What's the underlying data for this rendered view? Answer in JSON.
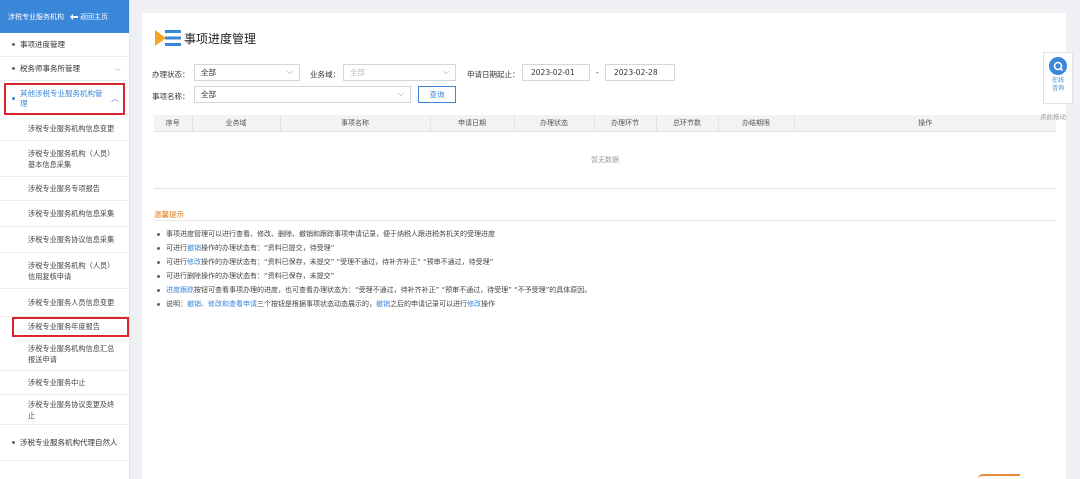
{
  "sidebar": {
    "top_title": "涉税专业服务机构",
    "back_label": "返回主页",
    "items": [
      {
        "label": "事项进度管理"
      },
      {
        "label": "税务师事务所管理"
      },
      {
        "label": "其他涉税专业服务机构管理"
      }
    ],
    "subitems": [
      {
        "label": "涉税专业服务机构信息变更"
      },
      {
        "label": "涉税专业服务机构（人员）基本信息采集"
      },
      {
        "label": "涉税专业服务专项报告"
      },
      {
        "label": "涉税专业服务机构信息采集"
      },
      {
        "label": "涉税专业服务协议信息采集"
      },
      {
        "label": "涉税专业服务机构（人员）信用复核申请"
      },
      {
        "label": "涉税专业服务人员信息变更"
      },
      {
        "label": "涉税专业服务年度报告"
      },
      {
        "label": "涉税专业服务机构信息汇总报送申请"
      },
      {
        "label": "涉税专业服务中止"
      },
      {
        "label": "涉税专业服务协议变更及终止"
      }
    ],
    "bottom_item": {
      "label": "涉税专业服务机构代理自然人"
    }
  },
  "page": {
    "title": "事项进度管理"
  },
  "filters": {
    "status_label": "办理状态：",
    "status_value": "全部",
    "business_label": "业务域：",
    "business_value": "全部",
    "date_label": "申请日期起止：",
    "date_from": "2023-02-01",
    "date_sep": "-",
    "date_to": "2023-02-28",
    "item_label": "事项名称：",
    "item_value": "全部",
    "query_button": "查询"
  },
  "table": {
    "columns": [
      "序号",
      "业务域",
      "事项名称",
      "申请日期",
      "办理状态",
      "办理环节",
      "总环节数",
      "办结期限",
      "操作"
    ],
    "empty_text": "暂无数据"
  },
  "tips": {
    "title": "温馨提示",
    "t1": "事项进度管理可以进行查看、修改、删除、撤销和跟踪事项申请记录，便于纳税人跟进税务机关的受理进度",
    "t2a": "可进行",
    "t2b": "撤销",
    "t2c": "操作的办理状态有：“资料已提交，待受理”",
    "t3a": "可进行",
    "t3b": "修改",
    "t3c": "操作的办理状态有：“资料已保存，未提交”  “受理不通过，待补齐补正”  “预审不通过，待受理”",
    "t4": "可进行删除操作的办理状态有：“资料已保存，未提交”",
    "t5a": "进度跟踪",
    "t5b": "按钮可查看事项办理的进度，也可查看办理状态为：“受理不通过，待补齐补正”  “预审不通过，待受理”  “不予受理”的具体原因。",
    "t6a": "说明：",
    "t6b": "撤销、修改和查看申请",
    "t6c": "三个按钮是根据事项状态动态展示的，",
    "t6d": "撤销",
    "t6e": "之后的申请记录可以进行",
    "t6f": "修改",
    "t6g": "操作"
  },
  "float": {
    "label1": "在线",
    "label2": "咨询",
    "drag": "点此拖动"
  },
  "colors": {
    "accent": "#3a86d8",
    "highlight": "#d9272e",
    "tip_title": "#e07a1a"
  }
}
